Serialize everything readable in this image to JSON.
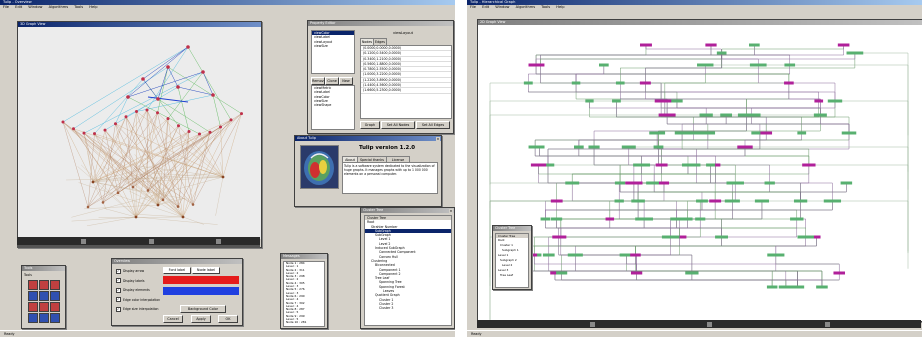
{
  "left": {
    "app_title": "Tulip - Overview",
    "menu": [
      "File",
      "Edit",
      "Window",
      "Algorithms",
      "Tools",
      "Help"
    ],
    "view_title": "3D Graph View",
    "property_panel": {
      "title": "Property Editor",
      "items": [
        "viewColor",
        "viewLabel",
        "viewLayout",
        "viewSize",
        "viewShape",
        "viewBorder"
      ],
      "selected_index": 0,
      "tabs": [
        "Nodes",
        "Edges"
      ],
      "column_title": "viewLayout",
      "rows": [
        "(0.0000,0.0000,0.0000)",
        "(0.1200,0.5400,0.0000)",
        "(0.3400,1.2100,0.0000)",
        "(0.5600,1.8800,0.0000)",
        "(0.7800,2.5500,0.0000)",
        "(1.0000,3.2200,0.0000)",
        "(1.2200,3.8900,0.0000)",
        "(1.4400,4.5600,0.0000)",
        "(1.6600,5.2300,0.0000)"
      ],
      "buttons": [
        "Remove",
        "Clone",
        "New"
      ],
      "lower_list": [
        "viewMetric",
        "viewLabel",
        "viewColor",
        "viewSize",
        "viewShape"
      ],
      "bottom_buttons": [
        "Graph",
        "Set All Nodes",
        "Set All Edges"
      ]
    },
    "about": {
      "title": "About Tulip",
      "heading": "Tulip version 1.2.0",
      "tabs": [
        "About",
        "Special thanks",
        "License"
      ],
      "text": "Tulip is a software system dedicated to the visualization of huge graphs. It manages graphs with up to 1 000 000 elements on a personal computer."
    },
    "cluster_tree": {
      "title": "Cluster Tree",
      "header": "Cluster Tree",
      "items": [
        {
          "label": "Root",
          "indent": 0,
          "selected": false
        },
        {
          "label": "Strahler Number",
          "indent": 1,
          "selected": false
        },
        {
          "label": "SubGraph",
          "indent": 2,
          "selected": true
        },
        {
          "label": "SubGraph",
          "indent": 2,
          "selected": false
        },
        {
          "label": "Level 1",
          "indent": 3,
          "selected": false
        },
        {
          "label": "Level 2",
          "indent": 3,
          "selected": false
        },
        {
          "label": "Induced SubGraph",
          "indent": 2,
          "selected": false
        },
        {
          "label": "Connected Component",
          "indent": 3,
          "selected": false
        },
        {
          "label": "Convex Hull",
          "indent": 3,
          "selected": false
        },
        {
          "label": "Clustering",
          "indent": 1,
          "selected": false
        },
        {
          "label": "Biconnected",
          "indent": 2,
          "selected": false
        },
        {
          "label": "Component 1",
          "indent": 3,
          "selected": false
        },
        {
          "label": "Component 2",
          "indent": 3,
          "selected": false
        },
        {
          "label": "Tree Leaf",
          "indent": 2,
          "selected": false
        },
        {
          "label": "Spanning Tree",
          "indent": 3,
          "selected": false
        },
        {
          "label": "Spanning Forest",
          "indent": 3,
          "selected": false
        },
        {
          "label": "Leaves",
          "indent": 4,
          "selected": false
        },
        {
          "label": "Quotient Graph",
          "indent": 2,
          "selected": false
        },
        {
          "label": "Cluster 1",
          "indent": 3,
          "selected": false
        },
        {
          "label": "Cluster 2",
          "indent": 3,
          "selected": false
        },
        {
          "label": "Cluster 3",
          "indent": 3,
          "selected": false
        }
      ]
    },
    "tools_panel": {
      "title": "Tools",
      "label": "Tools"
    },
    "overview_panel": {
      "title": "Overview",
      "options": [
        "Display arrow",
        "Display labels",
        "Display elements",
        "Edge color interpolation",
        "Edge size interpolation"
      ],
      "dropdown_values": [
        "Font label",
        "Node label"
      ],
      "color_bars": [
        "#e51b1b",
        "#1f3fe0"
      ],
      "background_button": "Background Color",
      "buttons": [
        "Cancel",
        "Apply",
        "OK"
      ]
    },
    "log_panel": {
      "title": "Messages",
      "lines": [
        "Node 1 : 284",
        "Level : 1",
        "Node 2 : 311",
        "Level : 2",
        "Node 3 : 298",
        "Level : 2",
        "Node 4 : 305",
        "Level : 3",
        "Node 5 : 276",
        "Level : 3",
        "Node 6 : 290",
        "Level : 4",
        "Node 7 : 302",
        "Level : 4",
        "Node 8 : 287",
        "Level : 5",
        "Node 9 : 299",
        "Level : 5",
        "Node 10 : 281"
      ]
    },
    "status": "Ready"
  },
  "right": {
    "app_title": "Tulip - Hierarchical Graph",
    "menu": [
      "File",
      "Edit",
      "Window",
      "Algorithms",
      "Tools",
      "Help"
    ],
    "view_title": "2D Graph View",
    "mini_tree": {
      "title": "Cluster Tree",
      "header": "Cluster Tree",
      "items": [
        "Root",
        "Cluster 1",
        "Subgraph 1",
        "Level 1",
        "Subgraph 2",
        "Level 2",
        "Level 3",
        "Tree Leaf"
      ]
    },
    "status": "Ready"
  },
  "colors": {
    "window_bg": "#d4d0c8",
    "title_active": "#0a246a",
    "node_red": "#c0304a",
    "node_purple": "#b0209a",
    "node_green": "#58b070"
  }
}
